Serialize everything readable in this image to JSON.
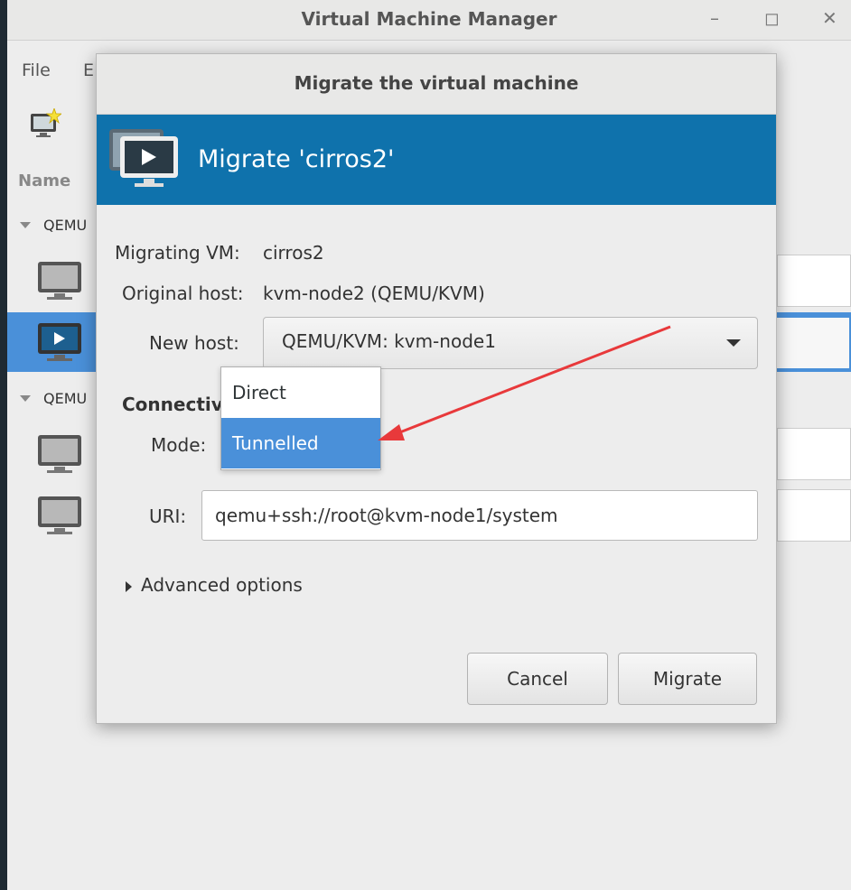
{
  "window": {
    "title": "Virtual Machine Manager"
  },
  "menubar": {
    "file": "File",
    "edit_partial": "E"
  },
  "list": {
    "column_name": "Name",
    "groups": [
      {
        "label": "QEMU"
      },
      {
        "label": "QEMU"
      }
    ]
  },
  "dialog": {
    "title": "Migrate the virtual machine",
    "banner_text": "Migrate 'cirros2'",
    "migrating_vm_label": "Migrating VM:",
    "migrating_vm_value": "cirros2",
    "original_host_label": "Original host:",
    "original_host_value": "kvm-node2 (QEMU/KVM)",
    "new_host_label": "New host:",
    "new_host_value": "QEMU/KVM: kvm-node1",
    "connectivity_label": "Connectiv",
    "mode_label": "Mode:",
    "mode_options": [
      "Direct",
      "Tunnelled"
    ],
    "mode_selected": "Tunnelled",
    "uri_label": "URI:",
    "uri_value": "qemu+ssh://root@kvm-node1/system",
    "advanced_label": "Advanced options",
    "cancel_label": "Cancel",
    "migrate_label": "Migrate"
  },
  "colors": {
    "banner": "#0f72ac",
    "selection": "#4a90d9",
    "annotation_arrow": "#e8393b"
  }
}
